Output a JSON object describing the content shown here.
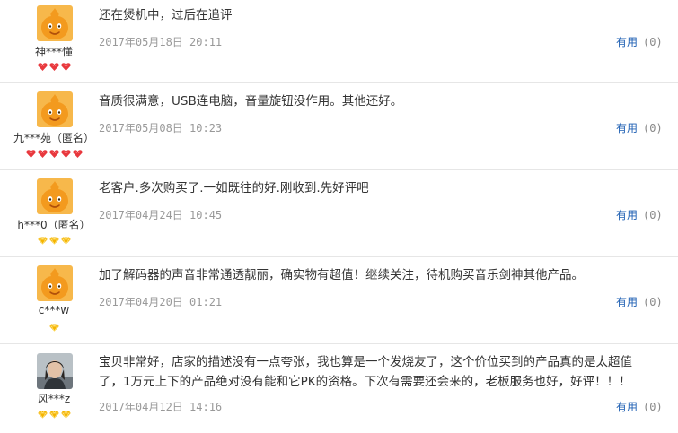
{
  "reviews": [
    {
      "username": "神***懂",
      "content": "还在煲机中，过后在追评",
      "date": "2017年05月18日 20:11",
      "useful_label": "有用",
      "useful_count": "(0)",
      "level_icon": "red-heart-gem",
      "level_count": 3,
      "avatar": "orange-mascot"
    },
    {
      "username": "九***苑（匿名）",
      "content": "音质很满意，USB连电脑，音量旋钮没作用。其他还好。",
      "date": "2017年05月08日 10:23",
      "useful_label": "有用",
      "useful_count": "(0)",
      "level_icon": "red-heart-gem",
      "level_count": 5,
      "avatar": "orange-mascot"
    },
    {
      "username": "h***0（匿名）",
      "content": "老客户.多次购买了.一如既往的好.刚收到.先好评吧",
      "date": "2017年04月24日 10:45",
      "useful_label": "有用",
      "useful_count": "(0)",
      "level_icon": "yellow-diamond",
      "level_count": 3,
      "avatar": "orange-mascot"
    },
    {
      "username": "c***w",
      "content": "加了解码器的声音非常通透靓丽，确实物有超值！继续关注，待机购买音乐剑神其他产品。",
      "date": "2017年04月20日 01:21",
      "useful_label": "有用",
      "useful_count": "(0)",
      "level_icon": "yellow-diamond",
      "level_count": 1,
      "avatar": "orange-mascot"
    },
    {
      "username": "风***z",
      "content": "宝贝非常好，店家的描述没有一点夸张，我也算是一个发烧友了，这个价位买到的产品真的是太超值了，1万元上下的产品绝对没有能和它PK的资格。下次有需要还会来的，老板服务也好，好评！！！",
      "date": "2017年04月12日 14:16",
      "useful_label": "有用",
      "useful_count": "(0)",
      "level_icon": "yellow-diamond",
      "level_count": 3,
      "avatar": "user-photo"
    }
  ],
  "colors": {
    "link": "#1e5fb3",
    "date": "#999999",
    "mascot": "#f39a1e",
    "heart_gem": "#e8383d",
    "diamond": "#f5b400",
    "divider": "#e6e6e6"
  }
}
